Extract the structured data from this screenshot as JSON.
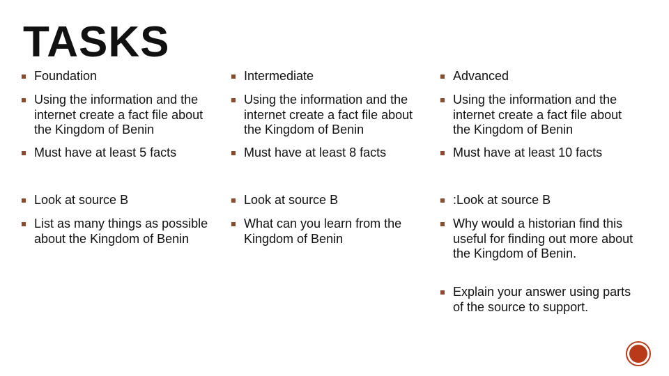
{
  "slide": {
    "title": "TASKS",
    "accent_color": "#8b4a2b",
    "logo_color": "#b93a18",
    "columns": [
      {
        "name": "foundation",
        "items": [
          "Foundation",
          "Using the information and the internet create a fact file about the Kingdom of Benin",
          "Must have at least 5 facts",
          "Look at source B",
          "List as many things as possible about the Kingdom of Benin"
        ]
      },
      {
        "name": "intermediate",
        "items": [
          "Intermediate",
          "Using the information and the internet create a fact file about the Kingdom of Benin",
          "Must have at least 8 facts",
          "Look at source B",
          "What can you learn from the Kingdom of Benin"
        ]
      },
      {
        "name": "advanced",
        "items": [
          "Advanced",
          "Using the information and the internet create a fact file about the Kingdom of Benin",
          "Must have at least 10 facts",
          ":Look at source B",
          "Why would a historian find this useful for finding out more about the Kingdom of Benin.",
          "Explain your answer using parts of the source to support."
        ]
      }
    ]
  }
}
